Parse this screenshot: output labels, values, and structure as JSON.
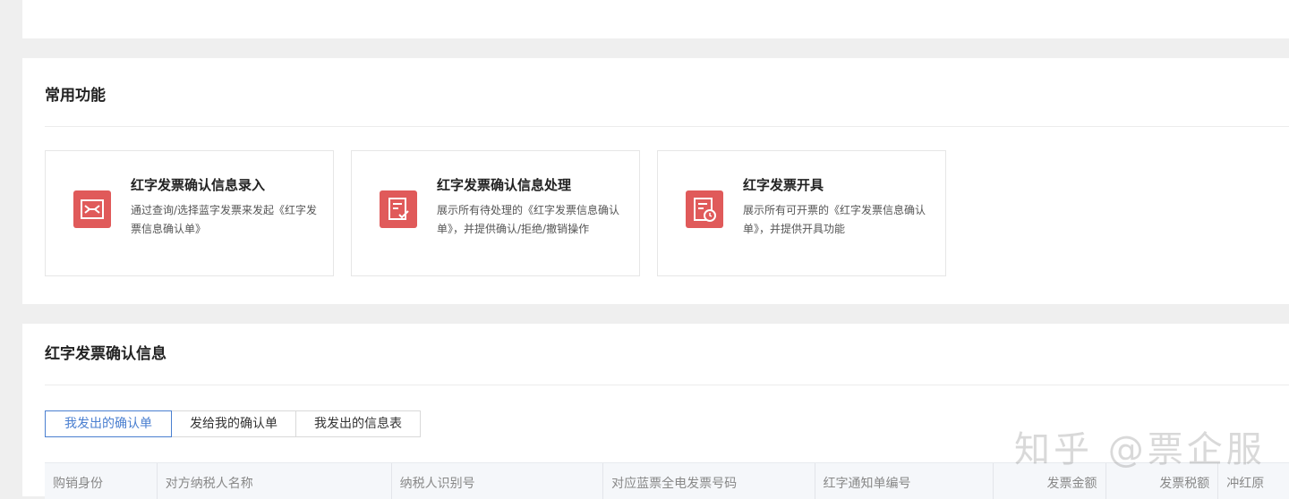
{
  "common_functions": {
    "title": "常用功能",
    "cards": [
      {
        "title": "红字发票确认信息录入",
        "desc": "通过查询/选择蓝字发票来发起《红字发票信息确认单》",
        "icon": "exchange-doc-icon"
      },
      {
        "title": "红字发票确认信息处理",
        "desc": "展示所有待处理的《红字发票信息确认单》，并提供确认/拒绝/撤销操作",
        "icon": "doc-check-icon"
      },
      {
        "title": "红字发票开具",
        "desc": "展示所有可开票的《红字发票信息确认单》，并提供开具功能",
        "icon": "doc-clock-icon"
      }
    ]
  },
  "info_section": {
    "title": "红字发票确认信息",
    "tabs": [
      {
        "label": "我发出的确认单",
        "active": true
      },
      {
        "label": "发给我的确认单",
        "active": false
      },
      {
        "label": "我发出的信息表",
        "active": false
      }
    ],
    "columns": [
      "购销身份",
      "对方纳税人名称",
      "纳税人识别号",
      "对应蓝票全电发票号码",
      "红字通知单编号",
      "发票金额",
      "发票税额",
      "冲红原"
    ]
  },
  "watermark": "知乎 @票企服",
  "colors": {
    "accent": "#4a7fd0",
    "icon_red": "#e05a5a"
  }
}
